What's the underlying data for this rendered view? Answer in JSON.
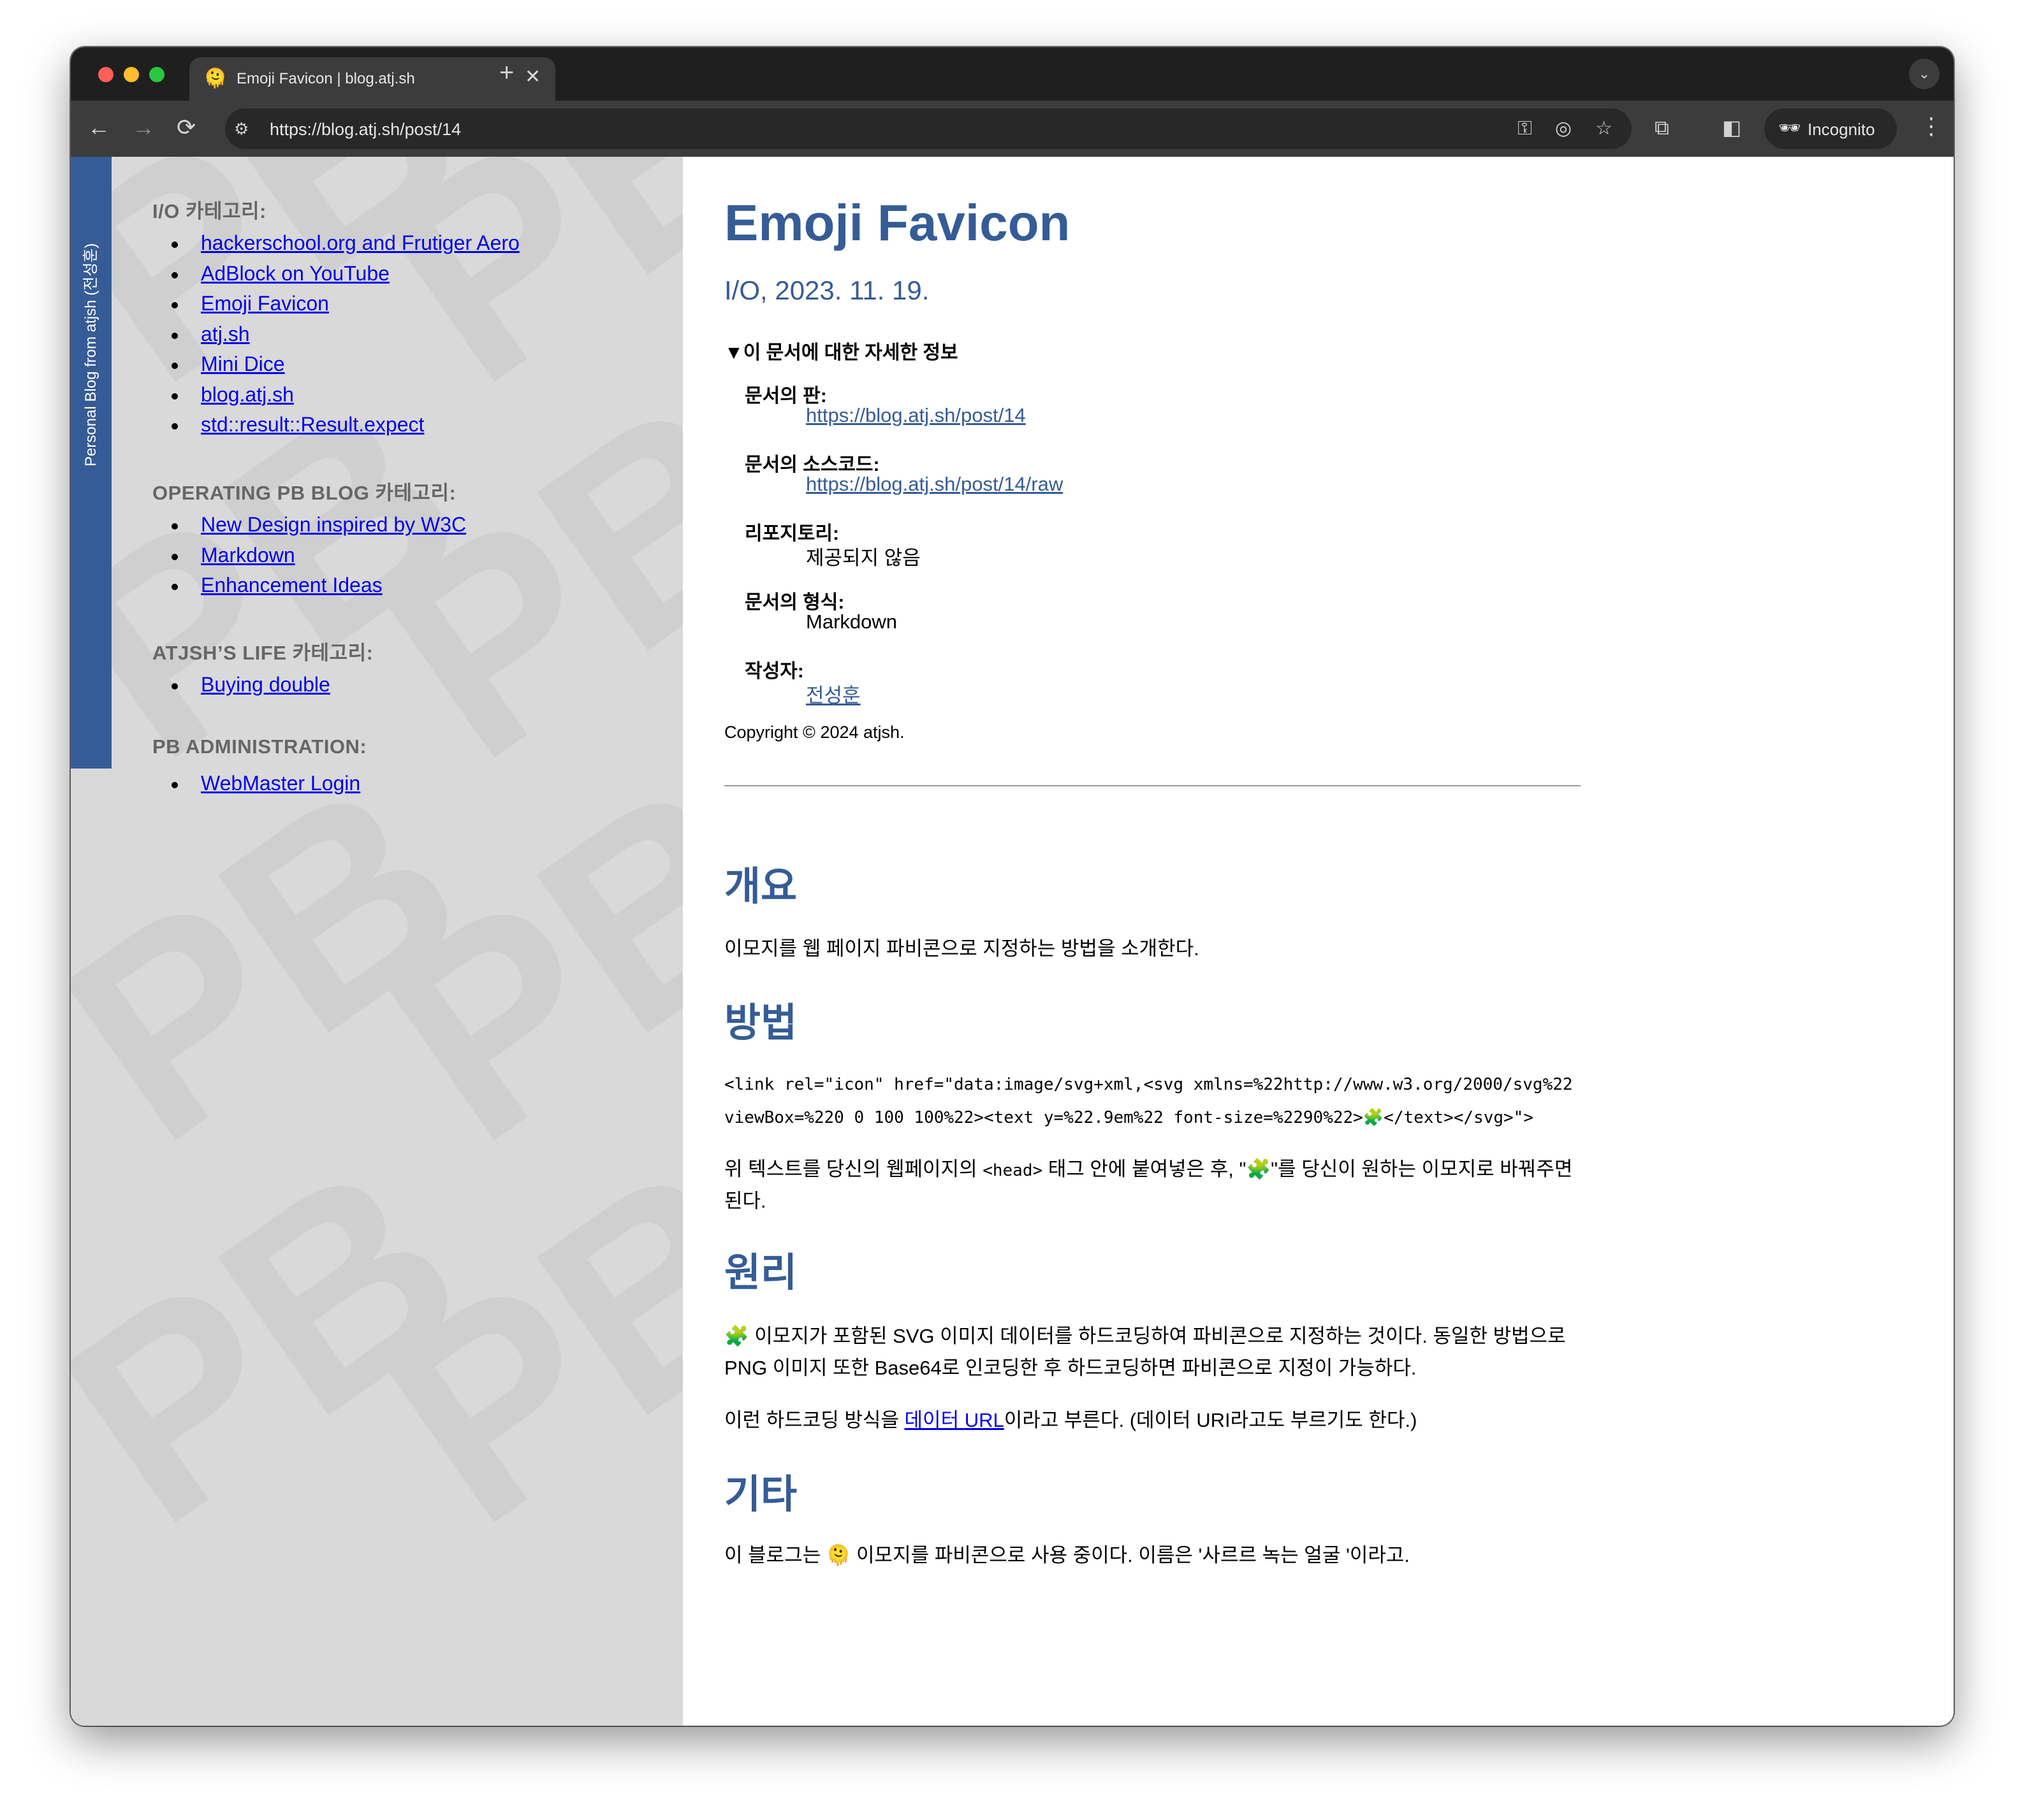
{
  "browser": {
    "tab": {
      "favicon": "🫠",
      "title": "Emoji Favicon | blog.atj.sh",
      "close": "✕"
    },
    "new_tab": "+",
    "tab_menu": "⌄",
    "nav": {
      "back": "←",
      "forward": "→",
      "reload": "⟳"
    },
    "url": "https://blog.atj.sh/post/14",
    "site_info": "⚙",
    "omnibox_icons": {
      "key": "⚿",
      "eye": "◎",
      "star": "☆"
    },
    "toolbar_icons": {
      "extensions": "⧉",
      "side_panel": "◧",
      "more": "⋮"
    },
    "incognito": {
      "icon": "🕶",
      "label": "Incognito"
    }
  },
  "sidebar": {
    "ribbon_text": "Personal Blog from atjsh (전성훈)",
    "watermark": "PB",
    "categories": [
      {
        "heading": "I/O 카테고리:",
        "links": [
          "hackerschool.org and Frutiger Aero",
          "AdBlock on YouTube",
          "Emoji Favicon",
          "atj.sh",
          "Mini Dice",
          "blog.atj.sh",
          "std::result::Result.expect"
        ]
      },
      {
        "heading": "OPERATING PB BLOG 카테고리:",
        "links": [
          "New Design inspired by W3C",
          "Markdown",
          "Enhancement Ideas"
        ]
      },
      {
        "heading": "ATJSH’S LIFE 카테고리:",
        "links": [
          "Buying double"
        ]
      },
      {
        "heading": "PB ADMINISTRATION:",
        "links": [
          "WebMaster Login"
        ]
      }
    ]
  },
  "article": {
    "title": "Emoji Favicon",
    "subtitle": "I/O, 2023. 11. 19.",
    "details_summary": "▼이 문서에 대한 자세한 정보",
    "details": [
      {
        "label": "문서의 판:",
        "value": "https://blog.atj.sh/post/14",
        "link": true
      },
      {
        "label": "문서의 소스코드:",
        "value": "https://blog.atj.sh/post/14/raw",
        "link": true
      },
      {
        "label": "리포지토리:",
        "value": "제공되지 않음",
        "link": false
      },
      {
        "label": "문서의 형식:",
        "value": "Markdown",
        "link": false
      },
      {
        "label": "작성자:",
        "value": "전성훈",
        "link": true
      }
    ],
    "copyright": "Copyright © 2024 atjsh.",
    "sections": {
      "overview": {
        "heading": "개요",
        "text": "이모지를 웹 페이지 파비콘으로 지정하는 방법을 소개한다."
      },
      "method": {
        "heading": "방법",
        "code_line1": "<link rel=\"icon\" href=\"data:image/svg+xml,<svg xmlns=%22http://www.w3.org/2000/svg%22",
        "code_line2": "viewBox=%220 0 100 100%22><text y=%22.9em%22 font-size=%2290%22>🧩</text></svg>\">",
        "text1_a": "위 텍스트를 당신의 웹페이지의 ",
        "text1_code": "<head>",
        "text1_b": " 태그 안에 붙여넣은 후, \"🧩\"를 당신이 원하는 이모지로 바꿔주면",
        "text2": "된다."
      },
      "principle": {
        "heading": "원리",
        "line1": "🧩 이모지가 포함된 SVG 이미지 데이터를 하드코딩하여 파비콘으로 지정하는 것이다. 동일한 방법으로",
        "line2": "PNG 이미지 또한 Base64로 인코딩한 후 하드코딩하면 파비콘으로 지정이 가능하다.",
        "line3_a": "이런 하드코딩 방식을 ",
        "line3_link": "데이터 URL",
        "line3_b": "이라고 부른다. (데이터 URI라고도 부르기도 한다.)"
      },
      "etc": {
        "heading": "기타",
        "text": "이 블로그는 🫠 이모지를 파비콘으로 사용 중이다. 이름은 '사르르 녹는 얼굴 '이라고."
      }
    }
  }
}
